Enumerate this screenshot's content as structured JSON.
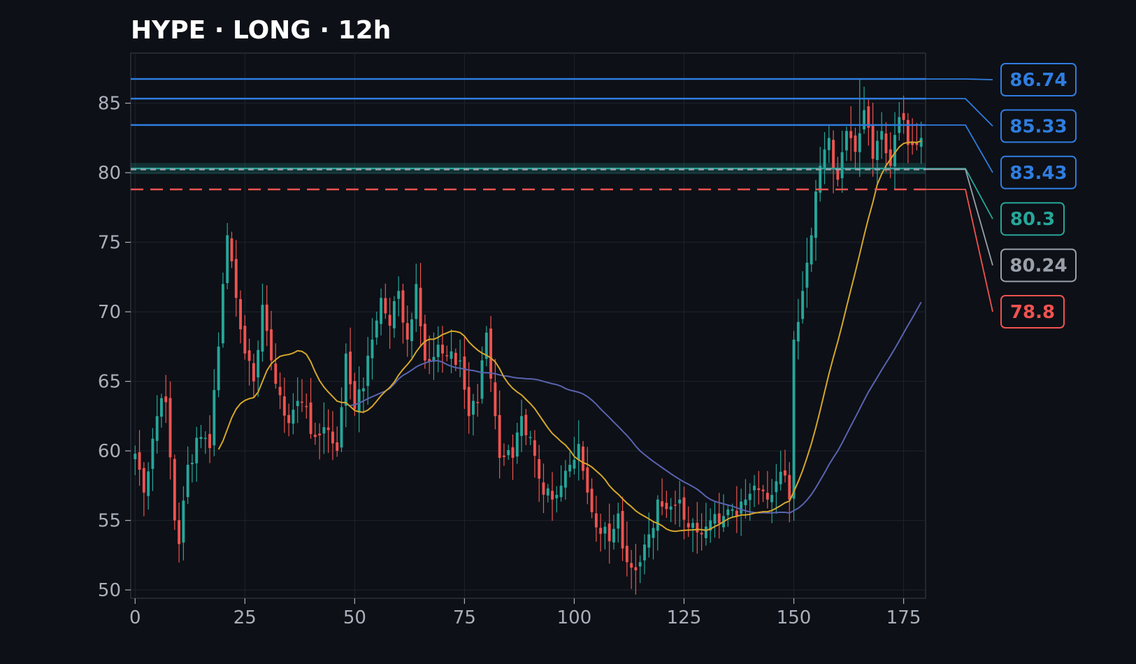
{
  "chart_data": {
    "type": "candlestick",
    "title": "HYPE · LONG · 12h",
    "xlabel": "",
    "ylabel": "",
    "xlim": [
      -1,
      180
    ],
    "ylim": [
      49.4,
      88.6
    ],
    "x_ticks": [
      0,
      25,
      50,
      75,
      100,
      125,
      150,
      175
    ],
    "y_ticks": [
      50,
      55,
      60,
      65,
      70,
      75,
      80,
      85
    ],
    "grid": true,
    "colors": {
      "up": "#26a69a",
      "down": "#ef5350",
      "ma_fast": "#d4a72c",
      "ma_slow": "#5a63b0",
      "target": "#2f7de1",
      "entry": "#26a69a",
      "current": "#9aa0aa",
      "stop": "#ef5350",
      "background": "#0d1016",
      "grid": "#1e232c"
    },
    "levels": [
      {
        "label": "86.74",
        "value": 86.74,
        "kind": "target"
      },
      {
        "label": "85.33",
        "value": 85.33,
        "kind": "target"
      },
      {
        "label": "83.43",
        "value": 83.43,
        "kind": "target"
      },
      {
        "label": "80.3",
        "value": 80.3,
        "kind": "entry"
      },
      {
        "label": "80.24",
        "value": 80.24,
        "kind": "current"
      },
      {
        "label": "78.8",
        "value": 78.8,
        "kind": "stop"
      }
    ],
    "entry_zone": [
      79.9,
      80.7
    ],
    "close_anchors": [
      [
        0,
        59.8
      ],
      [
        2,
        57.0
      ],
      [
        5,
        62.5
      ],
      [
        7,
        63.5
      ],
      [
        9,
        55.0
      ],
      [
        10,
        53.3
      ],
      [
        12,
        59.0
      ],
      [
        15,
        61.0
      ],
      [
        17,
        60.2
      ],
      [
        19,
        67.5
      ],
      [
        20,
        72.0
      ],
      [
        21,
        75.5
      ],
      [
        23,
        71.0
      ],
      [
        25,
        67.0
      ],
      [
        27,
        65.0
      ],
      [
        29,
        70.5
      ],
      [
        31,
        66.5
      ],
      [
        33,
        64.0
      ],
      [
        35,
        62.0
      ],
      [
        38,
        63.5
      ],
      [
        41,
        61.0
      ],
      [
        44,
        61.5
      ],
      [
        46,
        60.0
      ],
      [
        48,
        67.0
      ],
      [
        50,
        63.0
      ],
      [
        52,
        64.5
      ],
      [
        54,
        68.0
      ],
      [
        56,
        71.0
      ],
      [
        58,
        69.0
      ],
      [
        60,
        71.5
      ],
      [
        62,
        68.0
      ],
      [
        64,
        72.0
      ],
      [
        66,
        66.5
      ],
      [
        70,
        67.0
      ],
      [
        74,
        66.5
      ],
      [
        76,
        62.5
      ],
      [
        78,
        63.5
      ],
      [
        80,
        68.5
      ],
      [
        82,
        62.5
      ],
      [
        83,
        59.5
      ],
      [
        86,
        59.5
      ],
      [
        88,
        62.5
      ],
      [
        90,
        61.0
      ],
      [
        92,
        58.0
      ],
      [
        95,
        56.5
      ],
      [
        97,
        57.5
      ],
      [
        99,
        59.0
      ],
      [
        101,
        60.5
      ],
      [
        103,
        57.0
      ],
      [
        105,
        54.5
      ],
      [
        108,
        53.5
      ],
      [
        110,
        55.5
      ],
      [
        112,
        52.0
      ],
      [
        115,
        52.0
      ],
      [
        117,
        54.0
      ],
      [
        119,
        56.5
      ],
      [
        122,
        56.0
      ],
      [
        124,
        56.5
      ],
      [
        126,
        54.5
      ],
      [
        129,
        54.0
      ],
      [
        131,
        55.0
      ],
      [
        133,
        54.8
      ],
      [
        136,
        55.8
      ],
      [
        139,
        56.5
      ],
      [
        141,
        57.5
      ],
      [
        144,
        56.5
      ],
      [
        147,
        58.5
      ],
      [
        149,
        56.5
      ],
      [
        150,
        68.0
      ],
      [
        152,
        71.5
      ],
      [
        154,
        75.5
      ],
      [
        156,
        80.5
      ],
      [
        158,
        82.5
      ],
      [
        160,
        79.5
      ],
      [
        162,
        83.0
      ],
      [
        164,
        81.5
      ],
      [
        166,
        84.5
      ],
      [
        168,
        81.0
      ],
      [
        170,
        83.0
      ],
      [
        172,
        80.5
      ],
      [
        174,
        84.0
      ],
      [
        176,
        82.0
      ],
      [
        178,
        82.0
      ],
      [
        179,
        82.5
      ]
    ],
    "wick_max": 86.74,
    "ma_fast_period": 20,
    "ma_slow_period": 50
  }
}
